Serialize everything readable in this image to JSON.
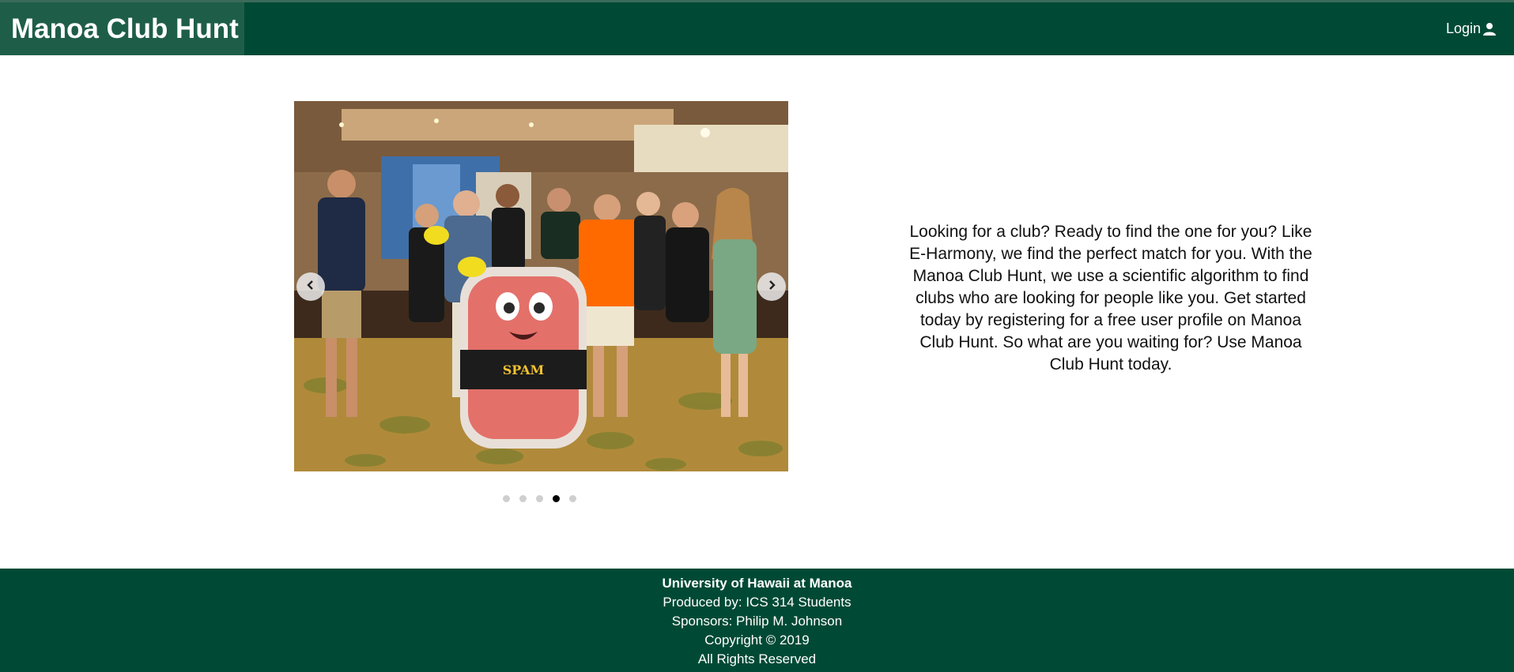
{
  "header": {
    "brand": "Manoa Club Hunt",
    "login_label": "Login",
    "login_icon": "user-icon"
  },
  "carousel": {
    "slide_count": 5,
    "active_index": 3,
    "prev_icon": "chevron-left-icon",
    "next_icon": "chevron-right-icon",
    "mascot_label": "SPAM"
  },
  "blurb": {
    "text": "Looking for a club? Ready to find the one for you? Like E-Harmony, we find the perfect match for you. With the Manoa Club Hunt, we use a scientific algorithm to find clubs who are looking for people like you. Get started today by registering for a free user profile on Manoa Club Hunt. So what are you waiting for? Use Manoa Club Hunt today."
  },
  "footer": {
    "org": "University of Hawaii at Manoa",
    "produced_by": "Produced by: ICS 314 Students",
    "sponsors": "Sponsors: Philip M. Johnson",
    "copyright": "Copyright © 2019",
    "rights": "All Rights Reserved"
  },
  "colors": {
    "brand_green": "#004a35",
    "brand_highlight": "#1e5e48"
  }
}
